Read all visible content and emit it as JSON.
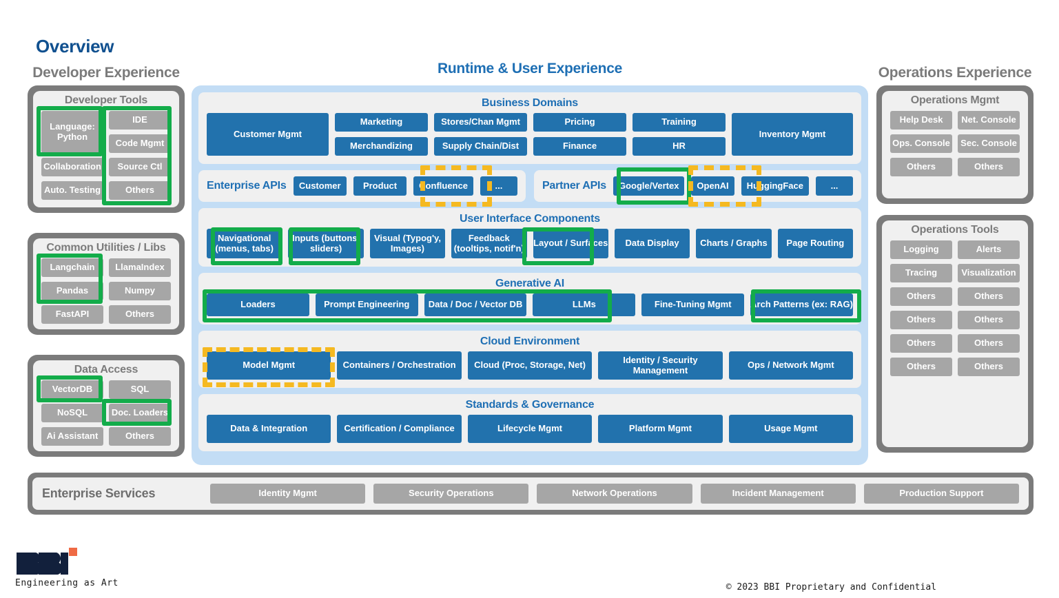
{
  "page": {
    "title": "Overview"
  },
  "columns": {
    "developer": {
      "heading": "Developer Experience"
    },
    "runtime": {
      "heading": "Runtime & User Experience"
    },
    "operations": {
      "heading": "Operations Experience"
    }
  },
  "developer": {
    "panels": [
      {
        "title": "Developer Tools",
        "items": [
          "Language: Python",
          "IDE",
          "Code Mgmt",
          "Collaboration",
          "Source Ctl",
          "Auto. Testing",
          "Others"
        ]
      },
      {
        "title": "Common Utilities / Libs",
        "items": [
          "Langchain",
          "LlamaIndex",
          "Pandas",
          "Numpy",
          "FastAPI",
          "Others"
        ]
      },
      {
        "title": "Data Access",
        "items": [
          "VectorDB",
          "SQL",
          "NoSQL",
          "Doc. Loaders",
          "Ai Assistant",
          "Others"
        ]
      }
    ]
  },
  "operations": {
    "panels": [
      {
        "title": "Operations Mgmt",
        "items": [
          "Help Desk",
          "Net. Console",
          "Ops. Console",
          "Sec. Console",
          "Others",
          "Others"
        ]
      },
      {
        "title": "Operations Tools",
        "items": [
          "Logging",
          "Alerts",
          "Tracing",
          "Visualization",
          "Others",
          "Others",
          "Others",
          "Others",
          "Others",
          "Others",
          "Others",
          "Others"
        ]
      }
    ]
  },
  "runtime": {
    "business_domains": {
      "title": "Business Domains",
      "wide_left": "Customer Mgmt",
      "pairs": [
        [
          "Marketing",
          "Merchandizing"
        ],
        [
          "Stores/Chan Mgmt",
          "Supply Chain/Dist"
        ],
        [
          "Pricing",
          "Finance"
        ],
        [
          "Training",
          "HR"
        ]
      ],
      "wide_right": "Inventory Mgmt"
    },
    "enterprise_apis": {
      "label": "Enterprise APIs",
      "items": [
        "Customer",
        "Product",
        "Confluence",
        "..."
      ]
    },
    "partner_apis": {
      "label": "Partner APIs",
      "items": [
        "Google/Vertex",
        "OpenAI",
        "HuggingFace",
        "..."
      ]
    },
    "ui_components": {
      "title": "User Interface Components",
      "items": [
        "Navigational (menus, tabs)",
        "Inputs (buttons, sliders)",
        "Visual (Typog'y, Images)",
        "Feedback (tooltips, notif'n)",
        "Layout / Surfaces",
        "Data Display",
        "Charts / Graphs",
        "Page Routing"
      ]
    },
    "generative_ai": {
      "title": "Generative AI",
      "items": [
        "Loaders",
        "Prompt Engineering",
        "Data / Doc / Vector DB",
        "LLMs",
        "Fine-Tuning Mgmt",
        "Arch Patterns (ex: RAG)"
      ]
    },
    "cloud_environment": {
      "title": "Cloud Environment",
      "items": [
        "Model Mgmt",
        "Containers / Orchestration",
        "Cloud (Proc, Storage, Net)",
        "Identity / Security Management",
        "Ops / Network Mgmt"
      ]
    },
    "standards_governance": {
      "title": "Standards & Governance",
      "items": [
        "Data & Integration",
        "Certification / Compliance",
        "Lifecycle Mgmt",
        "Platform Mgmt",
        "Usage Mgmt"
      ]
    }
  },
  "enterprise_services": {
    "label": "Enterprise Services",
    "items": [
      "Identity Mgmt",
      "Security Operations",
      "Network Operations",
      "Incident Management",
      "Production Support"
    ]
  },
  "brand": {
    "name": "BBI",
    "tagline": "Engineering as Art",
    "copyright": "© 2023 BBI Proprietary and Confidential"
  },
  "colors": {
    "title_blue": "#10508f",
    "section_blue": "#1e6fb4",
    "chip_blue": "#2272ad",
    "chip_grey": "#a6a6a6",
    "frame_grey": "#7b7b7b",
    "frame_blue": "#c3ddf5",
    "highlight_green": "#13ac4a",
    "highlight_yellow": "#f5b921",
    "brand_navy": "#12203c",
    "brand_orange": "#ef6a44"
  }
}
